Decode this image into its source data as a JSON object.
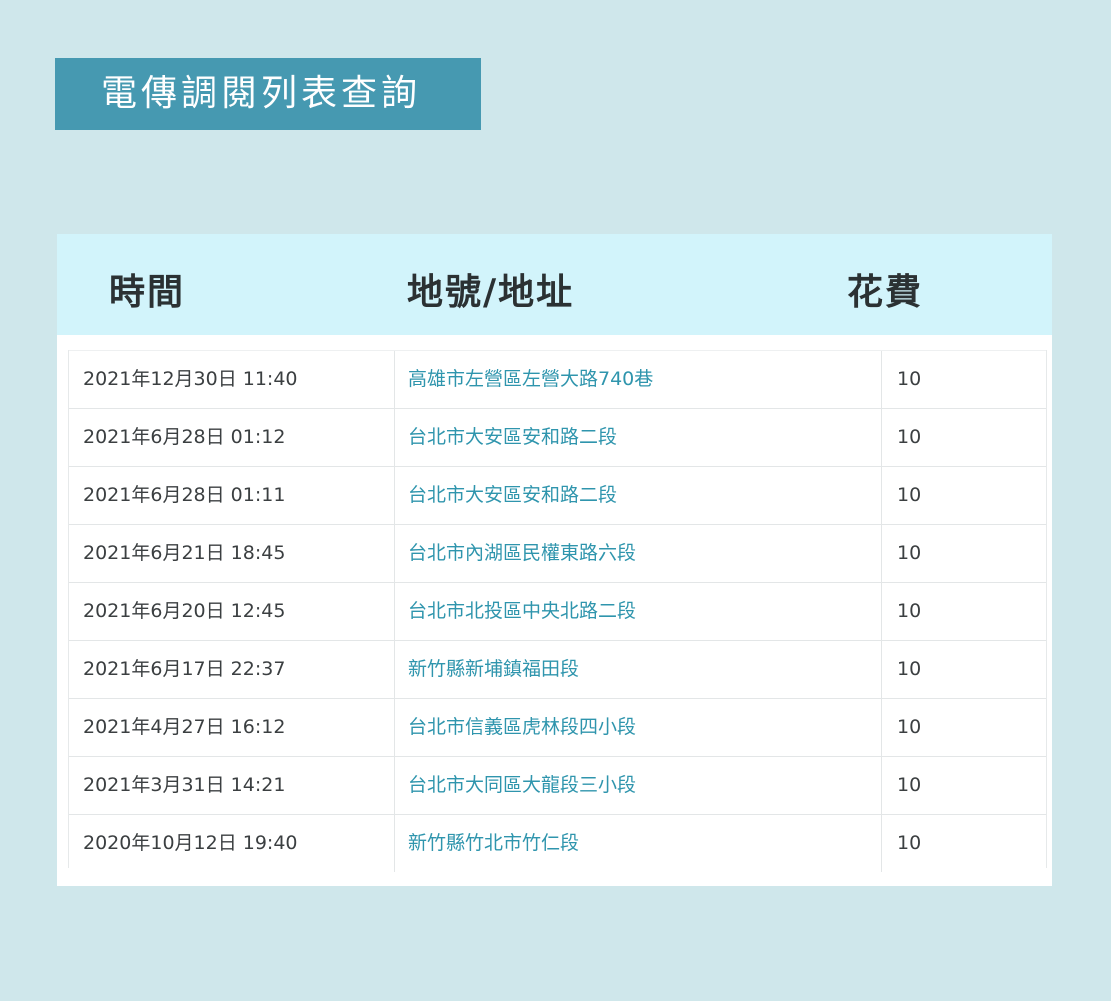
{
  "title": "電傳調閱列表查詢",
  "table": {
    "headers": {
      "time": "時間",
      "address": "地號/地址",
      "cost": "花費"
    },
    "rows": [
      {
        "time": "2021年12月30日 11:40",
        "address": "高雄市左營區左營大路740巷",
        "cost": "10"
      },
      {
        "time": "2021年6月28日 01:12",
        "address": "台北市大安區安和路二段",
        "cost": "10"
      },
      {
        "time": "2021年6月28日 01:11",
        "address": "台北市大安區安和路二段",
        "cost": "10"
      },
      {
        "time": "2021年6月21日 18:45",
        "address": "台北市內湖區民權東路六段",
        "cost": "10"
      },
      {
        "time": "2021年6月20日 12:45",
        "address": "台北市北投區中央北路二段",
        "cost": "10"
      },
      {
        "time": "2021年6月17日 22:37",
        "address": "新竹縣新埔鎮福田段",
        "cost": "10"
      },
      {
        "time": "2021年4月27日 16:12",
        "address": "台北市信義區虎林段四小段",
        "cost": "10"
      },
      {
        "time": "2021年3月31日 14:21",
        "address": "台北市大同區大龍段三小段",
        "cost": "10"
      },
      {
        "time": "2020年10月12日 19:40",
        "address": "新竹縣竹北市竹仁段",
        "cost": "10"
      }
    ]
  }
}
